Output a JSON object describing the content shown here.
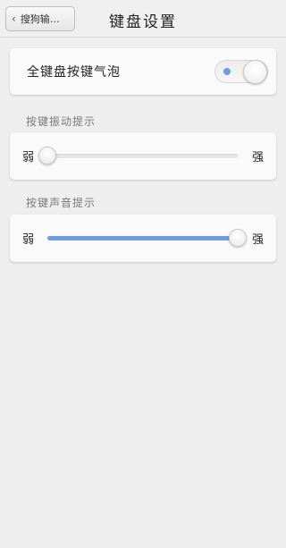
{
  "header": {
    "back_label": "搜狗输…",
    "title": "键盘设置"
  },
  "bubble": {
    "label": "全键盘按键气泡",
    "enabled": true
  },
  "vibration": {
    "section_label": "按键振动提示",
    "weak_label": "弱",
    "strong_label": "强",
    "level_percent": 0
  },
  "sound": {
    "section_label": "按键声音提示",
    "weak_label": "弱",
    "strong_label": "强",
    "level_percent": 100
  },
  "colors": {
    "accent": "#6f9ce6",
    "background": "#eeeeee",
    "card": "#fafafa"
  }
}
